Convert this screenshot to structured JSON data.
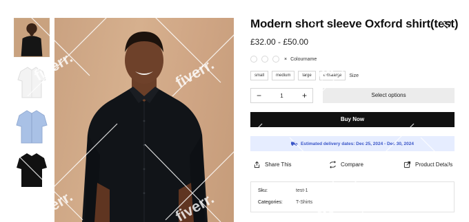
{
  "product": {
    "title": "Modern short sleeve Oxford shirt(test)",
    "price": "£32.00 - £50.00"
  },
  "gallery": {
    "thumbnails": [
      {
        "name": "model-black-shirt",
        "color": "#c9a27f"
      },
      {
        "name": "white-shirt",
        "color": "#f2f2f2"
      },
      {
        "name": "light-blue-shirt",
        "color": "#a9c1e6"
      },
      {
        "name": "black-shirt",
        "color": "#111111"
      }
    ]
  },
  "options": {
    "colour_label": "Colourname",
    "colour_clear": "×",
    "sizes": [
      "small",
      "medium",
      "large",
      "extralarge"
    ],
    "size_label": "Size"
  },
  "purchase": {
    "qty_minus": "−",
    "qty_value": "1",
    "qty_plus": "+",
    "select_options_label": "Select options",
    "buy_now_label": "Buy Now",
    "delivery_text": "Estimated delivery dates: Dec 25, 2024 - Dec 30, 2024"
  },
  "actions": {
    "share": "Share This",
    "compare": "Compare",
    "details": "Product Details"
  },
  "meta": {
    "sku_key": "Sku:",
    "sku_val": "test-1",
    "cat_key": "Categories:",
    "cat_val": "T-Shirts"
  },
  "watermark": {
    "text": "fiverr."
  },
  "colors": {
    "accent_blue": "#3a56c8",
    "delivery_bg": "#e6edff",
    "buy_bg": "#111111"
  }
}
